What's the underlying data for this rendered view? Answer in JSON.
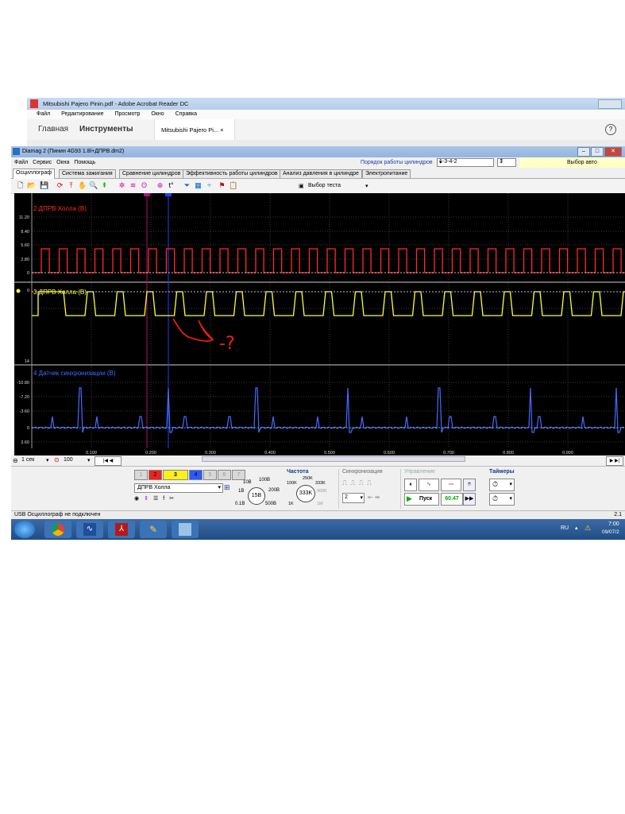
{
  "acrobat": {
    "title": "Mitsubishi Pajero Pinin.pdf - Adobe Acrobat Reader DC",
    "menu": [
      "Файл",
      "Редактирование",
      "Просмотр",
      "Окно",
      "Справка"
    ],
    "home_tab": "Главная",
    "tools_tab": "Инструменты",
    "doc_tab": "Mitsubishi Pajero Pi... ×",
    "help": "?"
  },
  "diamag": {
    "title": "Diamag 2 (Пинин 4G93 1.8l+ДПРВ.dm2)",
    "menu": [
      "Файл",
      "Сервис",
      "Окна",
      "Помощь"
    ],
    "firing_order_label": "Порядок работы цилиндров",
    "firing_order_value": "1-3-4-2",
    "spin_value": "1",
    "auto_select": "Выбор авто",
    "tabs": [
      "Осциллограф",
      "Система зажигания",
      "Сравнение цилиндров",
      "Эффективность работы цилиндров",
      "Анализ давления в цилиндре",
      "Электропитание"
    ],
    "test_select": "Выбор теста",
    "channels": [
      {
        "label": "2 ДПРВ Холла (В)",
        "color": "#ff2a2a"
      },
      {
        "label": "3 ДПРВ Холла (В)",
        "color": "#ffff33"
      },
      {
        "label": "4 Датчик синхронизации (В)",
        "color": "#3f6dff"
      }
    ],
    "y_ticks_ch2": [
      "11.20",
      "8.40",
      "5.60",
      "2.80",
      "0"
    ],
    "y_ticks_ch3": [
      "0",
      "14"
    ],
    "y_ticks_ch4": [
      "-10.80",
      "-7.20",
      "-3.60",
      "0",
      "3.60"
    ],
    "x_ticks": [
      "0.100",
      "0.200",
      "0.300",
      "0.400",
      "0.500",
      "0.600",
      "0.700",
      "0.800",
      "0.900"
    ],
    "annotation": "-?",
    "nav_time": "1 сек",
    "nav_count": "100",
    "channel_buttons": [
      "1",
      "2",
      "3",
      "4",
      "5",
      "6",
      "7"
    ],
    "channel_select": "ДПРВ Холла",
    "volt_ticks": [
      "10В",
      "100В",
      "1В",
      "200В",
      "0.1В",
      "500В"
    ],
    "volt_value": "15В",
    "freq_title": "Частота",
    "freq_ticks": [
      "250K",
      "100K",
      "333K",
      "500K",
      "1K",
      "1M"
    ],
    "freq_value": "333K",
    "sync_title": "Синхронизация",
    "sync_value": "2",
    "control_title": "Управление",
    "start_label": "Пуск",
    "rate_value": "60.47",
    "timers_title": "Таймеры",
    "status": "USB Осциллограф не подключен",
    "version": "2.1"
  },
  "taskbar": {
    "lang": "RU",
    "time": "7:00",
    "date": "09/07/2"
  }
}
